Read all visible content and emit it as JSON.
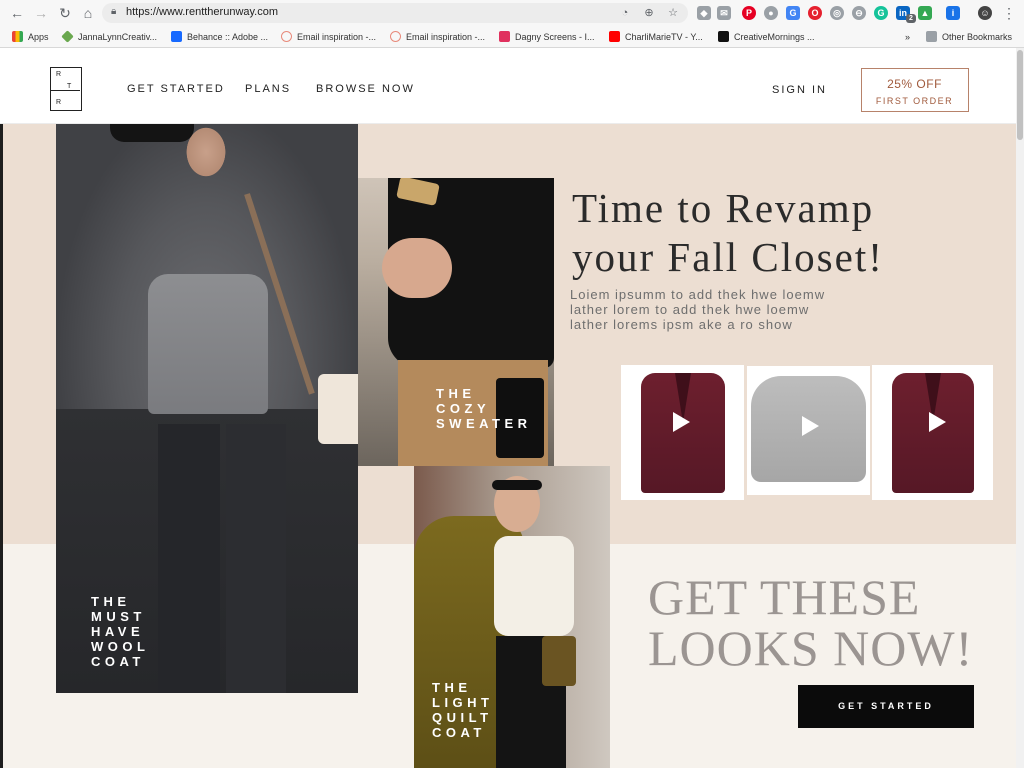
{
  "browser": {
    "url": "https://www.renttherunway.com",
    "bookmarks": [
      {
        "label": "Apps",
        "color": "#4285f4"
      },
      {
        "label": "JannaLynnCreativ...",
        "color": "#6aa84f"
      },
      {
        "label": "Behance :: Adobe ...",
        "color": "#1769ff"
      },
      {
        "label": "Email inspiration -...",
        "color": "#e88a7b"
      },
      {
        "label": "Email inspiration -...",
        "color": "#e88a7b"
      },
      {
        "label": "Dagny Screens - I...",
        "color": "#e0315e"
      },
      {
        "label": "CharliMarieTV - Y...",
        "color": "#ff0000"
      },
      {
        "label": "CreativeMornings ...",
        "color": "#111111"
      }
    ],
    "more_bookmarks": "»",
    "other_bookmarks": "Other Bookmarks",
    "extension_badge": "2"
  },
  "header": {
    "logo_letters": [
      "R",
      "T",
      "R"
    ],
    "nav": [
      "GET STARTED",
      "PLANS",
      "BROWSE NOW"
    ],
    "sign_in": "SIGN IN",
    "promo_line1": "25% OFF",
    "promo_line2": "FIRST ORDER",
    "accent_color": "#a05a3c"
  },
  "hero": {
    "title_line1": "Time to Revamp",
    "title_line2": "your Fall Closet!",
    "body_line1": "Loiem ipsumm to add thek hwe loemw",
    "body_line2": "lather lorem to add thek hwe loemw",
    "body_line3": "lather lorems ipsm ake a  ro show",
    "background_top": "#ecded2",
    "background_bottom": "#f6f2ec"
  },
  "photos": {
    "coat_caption": [
      "THE",
      "MUST",
      "HAVE",
      "WOOL",
      "COAT"
    ],
    "sweater_caption": [
      "THE",
      "COZY",
      "SWEATER"
    ],
    "quilt_caption": [
      "THE",
      "LIGHT",
      "QUILT",
      "COAT"
    ]
  },
  "products": [
    {
      "name": "burgundy-coat",
      "icon": "play-icon"
    },
    {
      "name": "grey-sweater",
      "icon": "play-icon"
    },
    {
      "name": "burgundy-coat",
      "icon": "play-icon"
    }
  ],
  "cta": {
    "title_line1": "GET THESE",
    "title_line2": "LOOKS NOW!",
    "button": "GET STARTED"
  }
}
